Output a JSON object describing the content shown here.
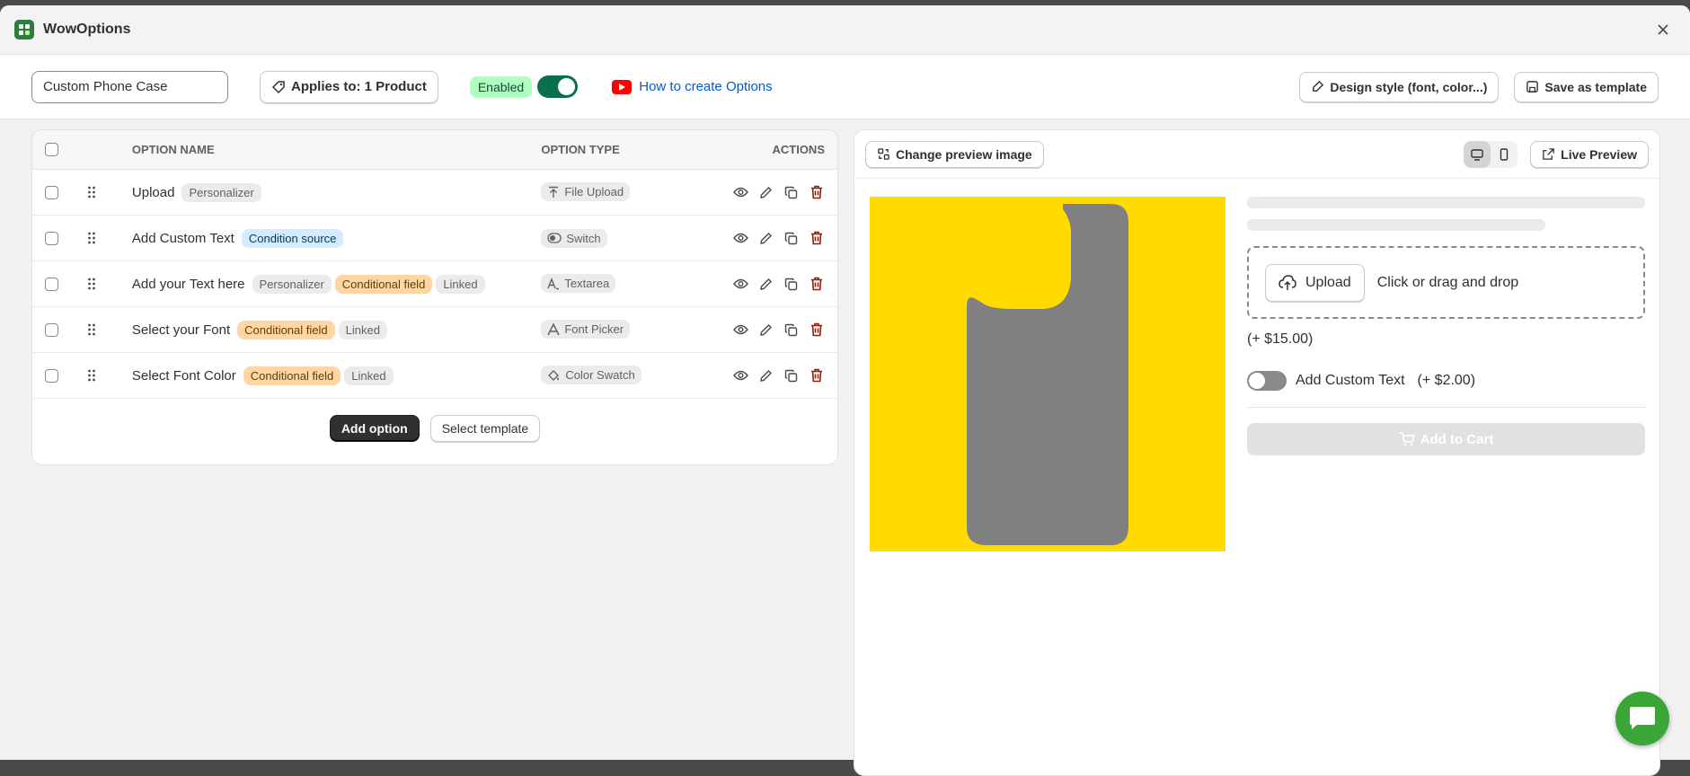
{
  "app": {
    "title": "WowOptions"
  },
  "toolbar": {
    "option_set_name": "Custom Phone Case",
    "applies_label": "Applies to: 1 Product",
    "enabled_label": "Enabled",
    "video_link": "How to create Options",
    "design_style_label": "Design style (font, color...)",
    "save_template_label": "Save as template"
  },
  "table": {
    "headers": {
      "name": "OPTION NAME",
      "type": "OPTION TYPE",
      "actions": "ACTIONS"
    },
    "rows": [
      {
        "name": "Upload",
        "badges": [
          "Personalizer"
        ],
        "type": "File Upload",
        "type_icon": "upload-icon"
      },
      {
        "name": "Add Custom Text",
        "badges": [
          "Condition source"
        ],
        "type": "Switch",
        "type_icon": "switch-icon"
      },
      {
        "name": "Add your Text here",
        "badges": [
          "Personalizer",
          "Conditional field",
          "Linked"
        ],
        "type": "Textarea",
        "type_icon": "textarea-icon"
      },
      {
        "name": "Select your Font",
        "badges": [
          "Conditional field",
          "Linked"
        ],
        "type": "Font Picker",
        "type_icon": "font-icon"
      },
      {
        "name": "Select Font Color",
        "badges": [
          "Conditional field",
          "Linked"
        ],
        "type": "Color Swatch",
        "type_icon": "color-swatch-icon"
      }
    ],
    "add_option_label": "Add option",
    "select_template_label": "Select template"
  },
  "preview": {
    "change_image_label": "Change preview image",
    "live_preview_label": "Live Preview",
    "upload_button": "Upload",
    "dropzone_text": "Click or drag and drop",
    "upload_price": "(+ $15.00)",
    "custom_text_label": "Add Custom Text",
    "custom_text_price": "(+ $2.00)",
    "add_to_cart": "Add to Cart"
  },
  "colors": {
    "accent": "#0b6e4f",
    "danger": "#8e1f0b",
    "preview_bg": "#ffdb00",
    "chat": "#3aa636"
  }
}
